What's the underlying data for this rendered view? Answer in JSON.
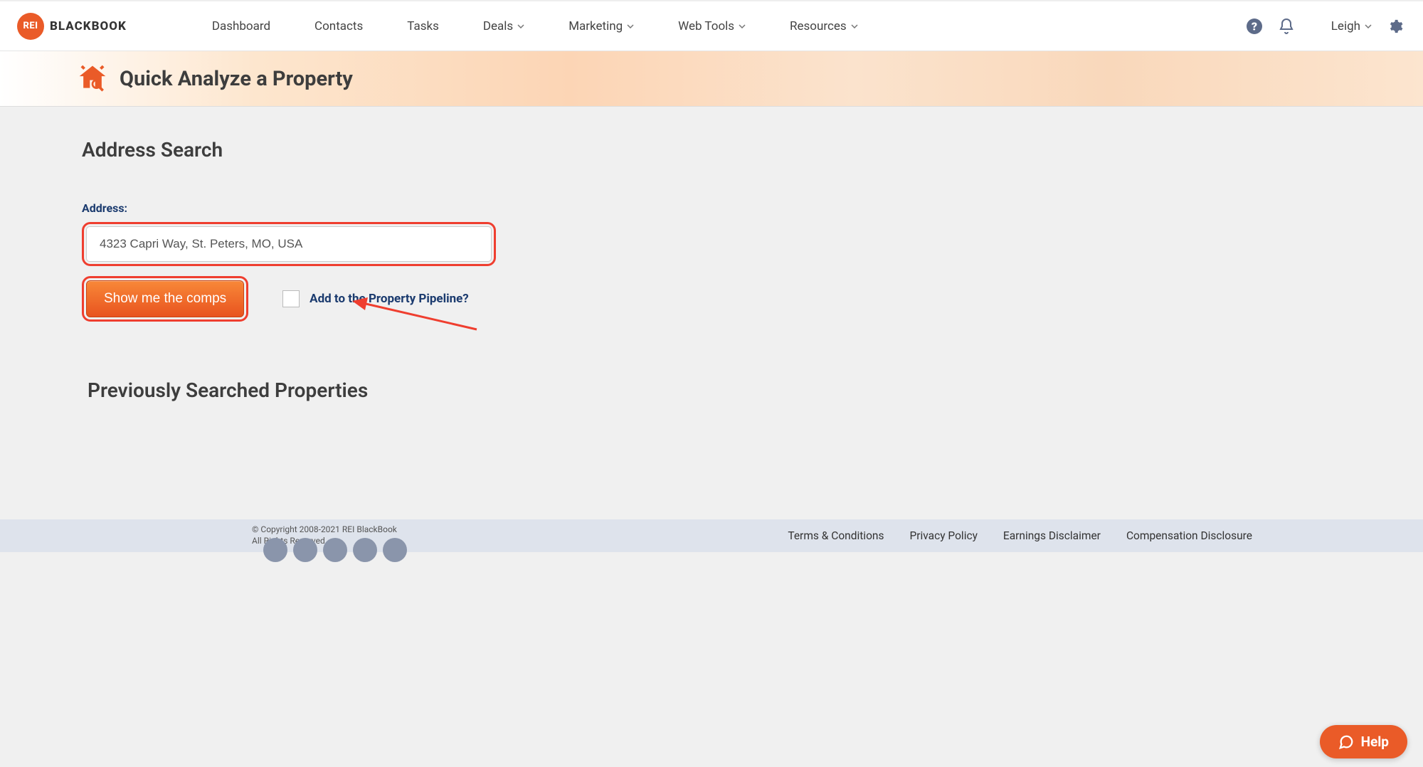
{
  "brand": {
    "badge": "REI",
    "name": "BLACKBOOK"
  },
  "nav": {
    "items": [
      {
        "label": "Dashboard",
        "dropdown": false
      },
      {
        "label": "Contacts",
        "dropdown": false
      },
      {
        "label": "Tasks",
        "dropdown": false
      },
      {
        "label": "Deals",
        "dropdown": true
      },
      {
        "label": "Marketing",
        "dropdown": true
      },
      {
        "label": "Web Tools",
        "dropdown": true
      },
      {
        "label": "Resources",
        "dropdown": true
      }
    ],
    "user": "Leigh"
  },
  "hero": {
    "title": "Quick Analyze a Property"
  },
  "search": {
    "section_title": "Address Search",
    "field_label": "Address:",
    "address_value": "4323 Capri Way, St. Peters, MO, USA",
    "button_label": "Show me the comps",
    "pipeline_label": "Add to the Property Pipeline?"
  },
  "previous": {
    "title": "Previously Searched Properties"
  },
  "footer": {
    "copyright_line1": "© Copyright 2008-2021 REI BlackBook",
    "copyright_line2": "All Rights Reserved",
    "links": [
      "Terms & Conditions",
      "Privacy Policy",
      "Earnings Disclaimer",
      "Compensation Disclosure"
    ]
  },
  "help": {
    "label": "Help"
  }
}
